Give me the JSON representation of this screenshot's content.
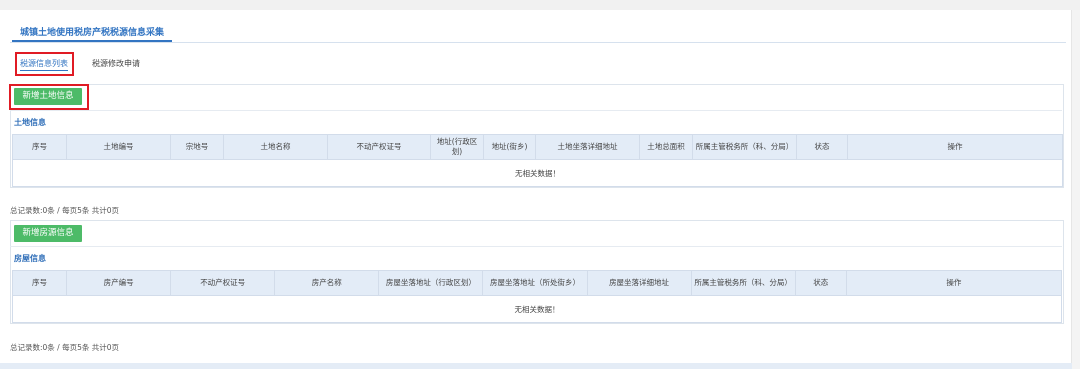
{
  "page": {
    "title": "城镇土地使用税房产税税源信息采集"
  },
  "tabs": [
    {
      "label": "税源信息列表",
      "active": true
    },
    {
      "label": "税源修改申请",
      "active": false
    }
  ],
  "land": {
    "add_button": "新增土地信息",
    "section_title": "土地信息",
    "columns": [
      "序号",
      "土地编号",
      "宗地号",
      "土地名称",
      "不动产权证号",
      "地址(行政区划)",
      "地址(街乡)",
      "土地坐落详细地址",
      "土地总面积",
      "所属主管税务所（科、分局）",
      "状态",
      "操作"
    ],
    "empty_text": "无相关数据！",
    "pager": "总记录数:0条 / 每页5条 共计0页"
  },
  "house": {
    "add_button": "新增房源信息",
    "section_title": "房屋信息",
    "columns": [
      "序号",
      "房产编号",
      "不动产权证号",
      "房产名称",
      "房屋坐落地址（行政区划）",
      "房屋坐落地址（所处街乡）",
      "房屋坐落详细地址",
      "所属主管税务所（科、分局）",
      "状态",
      "操作"
    ],
    "empty_text": "无相关数据！",
    "pager": "总记录数:0条 / 每页5条 共计0页"
  },
  "colors": {
    "accent": "#3375c2",
    "green": "#4dbb68",
    "highlight": "#e01b24",
    "header_bg": "#e3ecf7"
  }
}
